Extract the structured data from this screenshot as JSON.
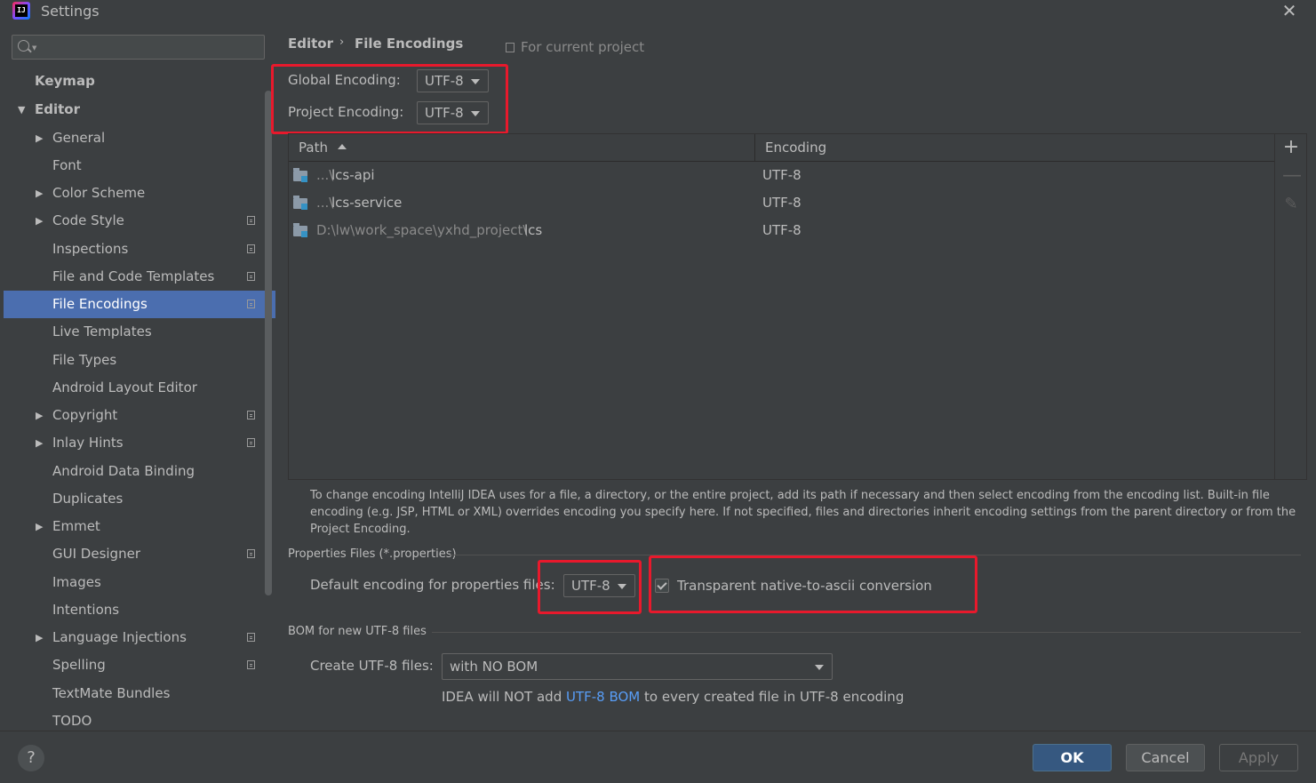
{
  "window": {
    "title": "Settings",
    "app_icon_text": "IJ"
  },
  "search": {
    "placeholder": ""
  },
  "sidebar": {
    "items": [
      {
        "label": "Keymap"
      },
      {
        "label": "Editor"
      },
      {
        "label": "General"
      },
      {
        "label": "Font"
      },
      {
        "label": "Color Scheme"
      },
      {
        "label": "Code Style"
      },
      {
        "label": "Inspections"
      },
      {
        "label": "File and Code Templates"
      },
      {
        "label": "File Encodings"
      },
      {
        "label": "Live Templates"
      },
      {
        "label": "File Types"
      },
      {
        "label": "Android Layout Editor"
      },
      {
        "label": "Copyright"
      },
      {
        "label": "Inlay Hints"
      },
      {
        "label": "Android Data Binding"
      },
      {
        "label": "Duplicates"
      },
      {
        "label": "Emmet"
      },
      {
        "label": "GUI Designer"
      },
      {
        "label": "Images"
      },
      {
        "label": "Intentions"
      },
      {
        "label": "Language Injections"
      },
      {
        "label": "Spelling"
      },
      {
        "label": "TextMate Bundles"
      },
      {
        "label": "TODO"
      }
    ]
  },
  "breadcrumb": {
    "parent": "Editor",
    "separator": "›",
    "current": "File Encodings",
    "scope": "For current project"
  },
  "encodings": {
    "global_label": "Global Encoding:",
    "global_value": "UTF-8",
    "project_label": "Project Encoding:",
    "project_value": "UTF-8"
  },
  "table": {
    "columns": {
      "path": "Path",
      "encoding": "Encoding"
    },
    "rows": [
      {
        "prefix": "...\\",
        "name": "lcs-api",
        "encoding": "UTF-8"
      },
      {
        "prefix": "...\\",
        "name": "lcs-service",
        "encoding": "UTF-8"
      },
      {
        "prefix": "D:\\lw\\work_space\\yxhd_project\\",
        "name": "lcs",
        "encoding": "UTF-8"
      }
    ],
    "tools": {
      "add": "+",
      "remove": "—",
      "edit": "✎"
    }
  },
  "help_text": "To change encoding IntelliJ IDEA uses for a file, a directory, or the entire project, add its path if necessary and then select encoding from the encoding list. Built-in file encoding (e.g. JSP, HTML or XML) overrides encoding you specify here. If not specified, files and directories inherit encoding settings from the parent directory or from the Project Encoding.",
  "properties": {
    "section_title": "Properties Files (*.properties)",
    "default_label": "Default encoding for properties files:",
    "default_value": "UTF-8",
    "transparent_label": "Transparent native-to-ascii conversion",
    "transparent_checked": true
  },
  "bom": {
    "section_title": "BOM for new UTF-8 files",
    "create_label": "Create UTF-8 files:",
    "create_value": "with NO BOM",
    "note_before": "IDEA will NOT add ",
    "note_link": "UTF-8 BOM",
    "note_after": " to every created file in UTF-8 encoding"
  },
  "footer": {
    "help": "?",
    "ok": "OK",
    "cancel": "Cancel",
    "apply": "Apply"
  },
  "colors": {
    "background": "#3c3f41",
    "selection": "#4b6eaf",
    "highlight_box": "#e8192c",
    "link": "#589df6",
    "default_button": "#365880"
  }
}
